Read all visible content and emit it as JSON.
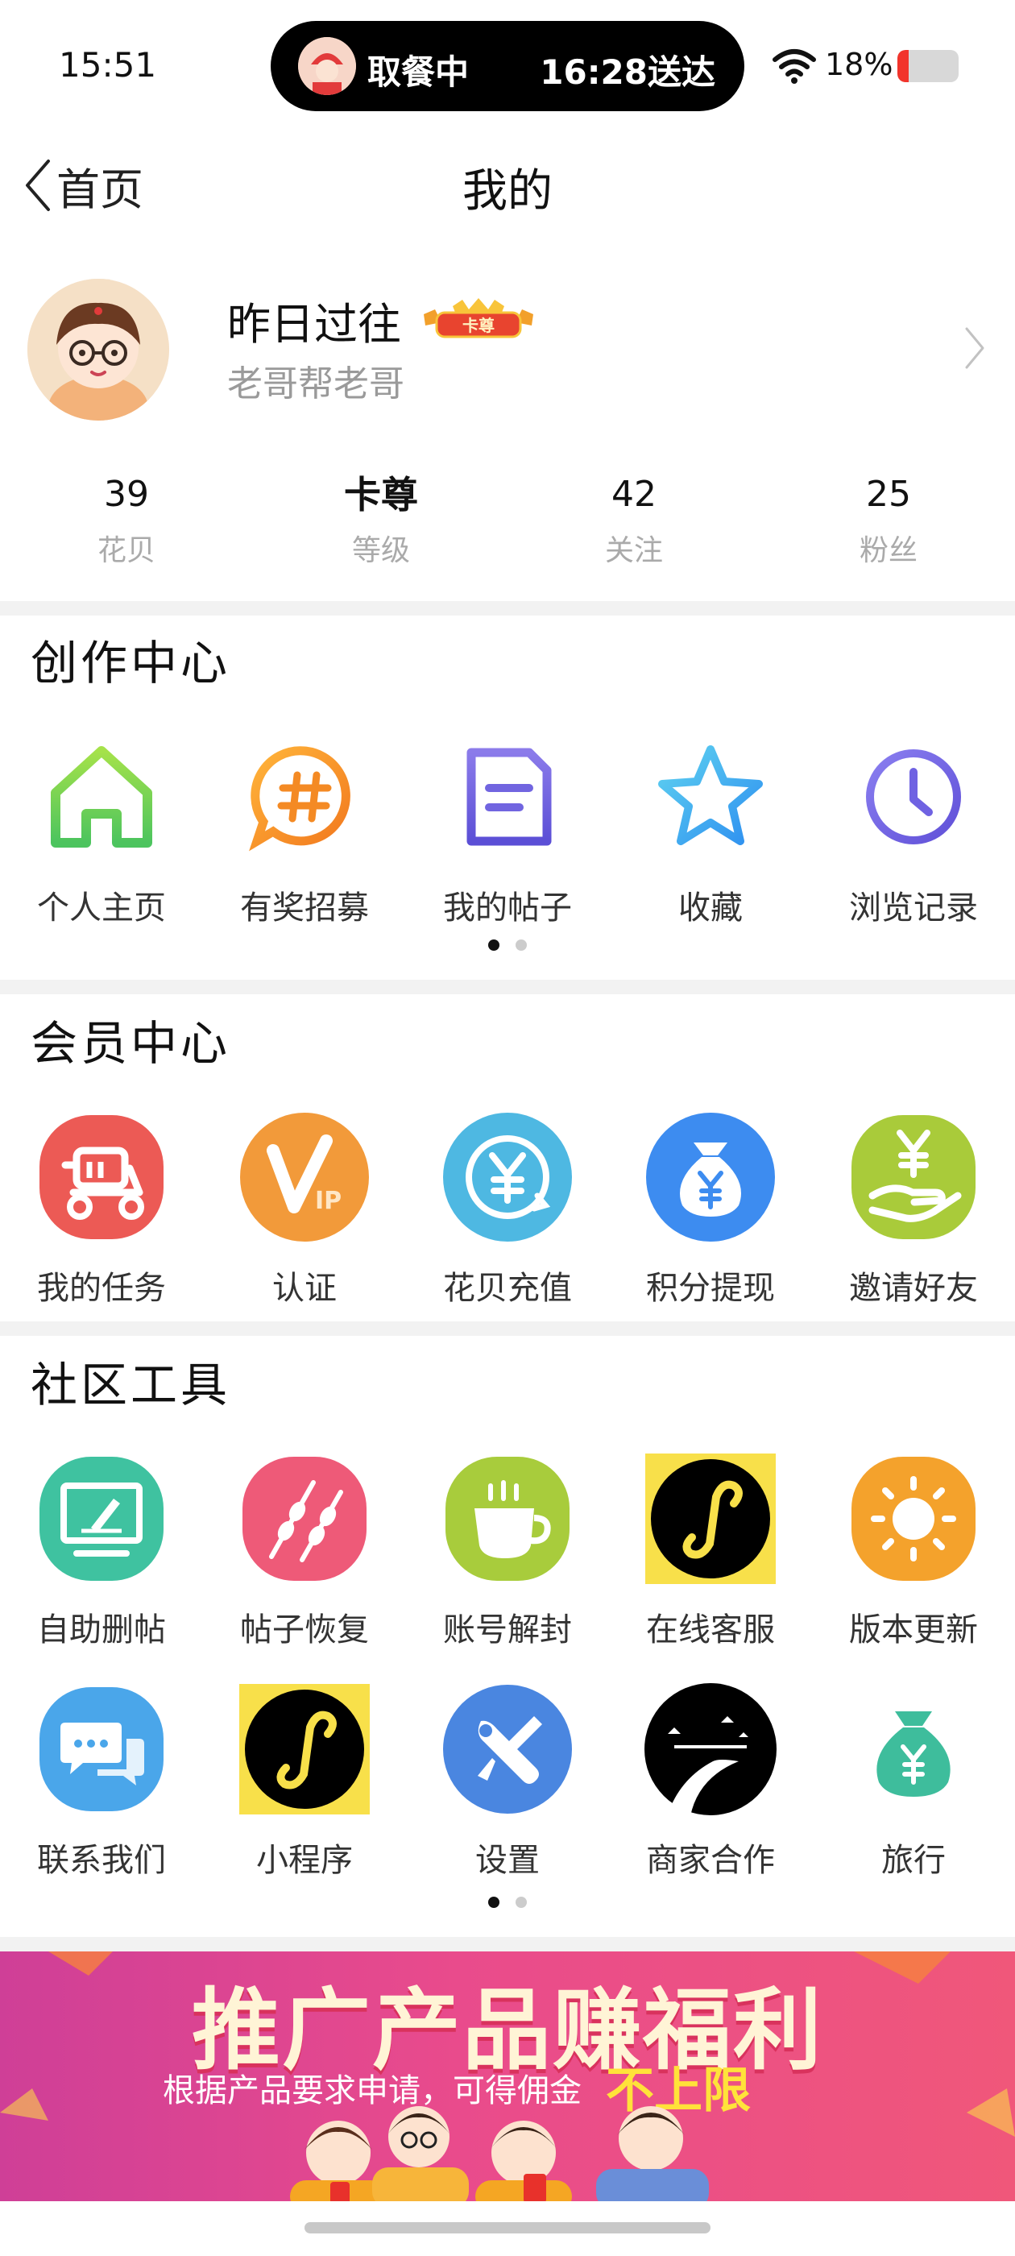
{
  "status_bar": {
    "time": "15:51",
    "island_left": "取餐中",
    "island_right": "16:28送达",
    "battery_percent": "18%",
    "battery_level": 0.18
  },
  "nav": {
    "back_label": "首页",
    "title": "我的"
  },
  "profile": {
    "username": "昨日过往",
    "badge": "卡尊",
    "signature": "老哥帮老哥"
  },
  "stats": [
    {
      "value": "39",
      "label": "花贝"
    },
    {
      "value": "卡尊",
      "label": "等级"
    },
    {
      "value": "42",
      "label": "关注"
    },
    {
      "value": "25",
      "label": "粉丝"
    }
  ],
  "creation_center": {
    "title": "创作中心",
    "items": [
      {
        "label": "个人主页",
        "icon": "home-icon"
      },
      {
        "label": "有奖招募",
        "icon": "hashtag-icon"
      },
      {
        "label": "我的帖子",
        "icon": "document-icon"
      },
      {
        "label": "收藏",
        "icon": "star-icon"
      },
      {
        "label": "浏览记录",
        "icon": "clock-icon"
      }
    ],
    "page": 1,
    "pages": 2
  },
  "member_center": {
    "title": "会员中心",
    "items": [
      {
        "label": "我的任务",
        "icon": "scooter-icon"
      },
      {
        "label": "认证",
        "icon": "vip-icon"
      },
      {
        "label": "花贝充值",
        "icon": "yuan-coin-icon"
      },
      {
        "label": "积分提现",
        "icon": "money-bag-icon"
      },
      {
        "label": "邀请好友",
        "icon": "hand-money-icon"
      }
    ]
  },
  "community_tools": {
    "title": "社区工具",
    "row1": [
      {
        "label": "自助删帖",
        "icon": "monitor-edit-icon"
      },
      {
        "label": "帖子恢复",
        "icon": "skewer-icon"
      },
      {
        "label": "账号解封",
        "icon": "cup-icon"
      },
      {
        "label": "在线客服",
        "icon": "mini-program-icon"
      },
      {
        "label": "版本更新",
        "icon": "sun-icon"
      }
    ],
    "row2": [
      {
        "label": "联系我们",
        "icon": "chat-icon"
      },
      {
        "label": "小程序",
        "icon": "mini-program-icon"
      },
      {
        "label": "设置",
        "icon": "tools-icon"
      },
      {
        "label": "商家合作",
        "icon": "road-icon"
      },
      {
        "label": "旅行",
        "icon": "money-bag-icon"
      }
    ],
    "page": 1,
    "pages": 2
  },
  "banner": {
    "title": "推广产品赚福利",
    "subtitle": "根据产品要求申请，可得佣金",
    "highlight": "不上限"
  },
  "colors": {
    "accent_pink": "#e94b8c",
    "highlight_yellow": "#ffe23a",
    "dot_active": "#111111",
    "dot_inactive": "#cccccc"
  }
}
